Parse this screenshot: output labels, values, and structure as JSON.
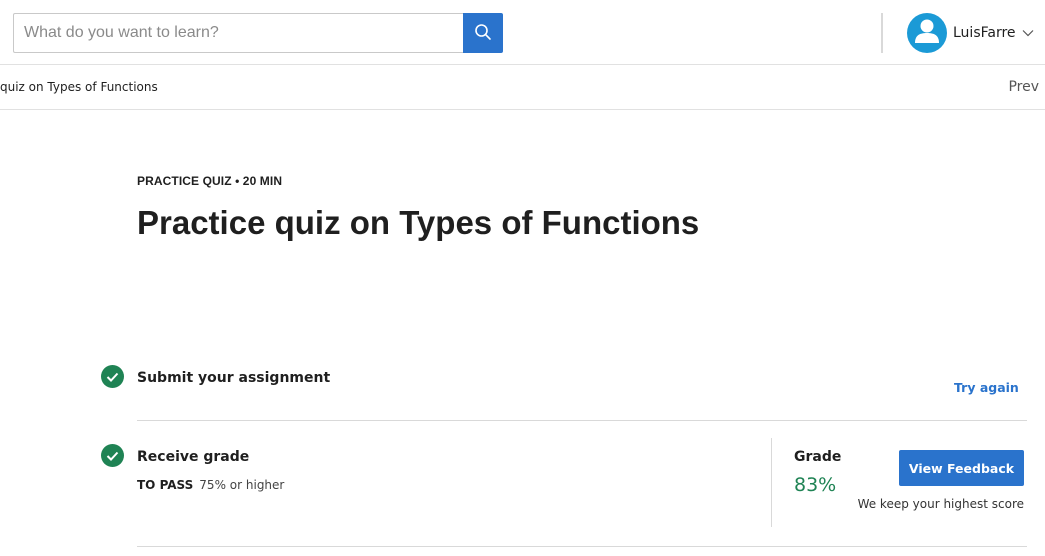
{
  "header": {
    "search": {
      "placeholder": "What do you want to learn?",
      "value": "",
      "icon": "search-icon"
    },
    "user": {
      "name": "LuisFarre",
      "avatar_icon": "user-icon",
      "menu_icon": "chevron-down-icon"
    }
  },
  "breadcrumb": {
    "current": "quiz on Types of Functions",
    "prev_label": "Prev"
  },
  "page": {
    "eyebrow": "PRACTICE QUIZ • 20 MIN",
    "title": "Practice quiz on Types of Functions"
  },
  "steps": {
    "submit": {
      "label": "Submit your assignment",
      "action_label": "Try again",
      "status": "complete"
    },
    "grade": {
      "label": "Receive grade",
      "to_pass_label": "TO PASS",
      "to_pass_value": "75% or higher",
      "grade_label": "Grade",
      "grade_value": "83%",
      "button_label": "View Feedback",
      "note": "We keep your highest score",
      "status": "complete"
    }
  },
  "colors": {
    "accent": "#2a73cc",
    "success": "#1f8354",
    "avatar": "#1b9ad6"
  }
}
